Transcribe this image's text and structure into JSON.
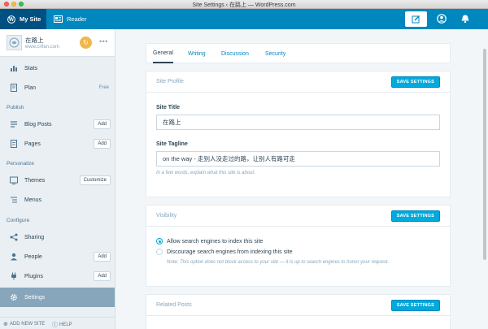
{
  "window": {
    "title": "Site Settings ‹ 在路上 — WordPress.com"
  },
  "masterbar": {
    "my_site_label": "My Site",
    "reader_label": "Reader",
    "write_icon": "pencil-square-icon",
    "me_icon": "user-circle-icon",
    "notifications_icon": "bell-icon"
  },
  "site": {
    "name": "在路上",
    "url": "www.crifan.com"
  },
  "sidebar": {
    "items": [
      {
        "label": "Stats",
        "icon": "stats-icon"
      },
      {
        "label": "Plan",
        "icon": "plan-icon",
        "badge": "Free"
      }
    ],
    "publish_heading": "Publish",
    "publish_items": [
      {
        "label": "Blog Posts",
        "icon": "posts-icon",
        "button": "Add"
      },
      {
        "label": "Pages",
        "icon": "pages-icon",
        "button": "Add"
      }
    ],
    "personalize_heading": "Personalize",
    "personalize_items": [
      {
        "label": "Themes",
        "icon": "themes-icon",
        "button": "Customize"
      },
      {
        "label": "Menus",
        "icon": "menus-icon"
      }
    ],
    "configure_heading": "Configure",
    "configure_items": [
      {
        "label": "Sharing",
        "icon": "share-icon"
      },
      {
        "label": "People",
        "icon": "people-icon",
        "button": "Add"
      },
      {
        "label": "Plugins",
        "icon": "plugins-icon",
        "button": "Add"
      },
      {
        "label": "Settings",
        "icon": "cog-icon",
        "selected": true
      }
    ],
    "footer": {
      "add_site": "ADD NEW SITE",
      "help": "HELP"
    }
  },
  "tabs": [
    {
      "label": "General",
      "active": true
    },
    {
      "label": "Writing"
    },
    {
      "label": "Discussion"
    },
    {
      "label": "Security"
    }
  ],
  "site_profile": {
    "title": "Site Profile",
    "save_label": "SAVE SETTINGS",
    "site_title_label": "Site Title",
    "site_title_value": "在路上",
    "tagline_label": "Site Tagline",
    "tagline_value": "on the way - 走别人没走过的路，让别人有路可走",
    "tagline_help": "In a few words, explain what this site is about."
  },
  "visibility": {
    "title": "Visibility",
    "save_label": "SAVE SETTINGS",
    "option_allow": "Allow search engines to index this site",
    "option_discourage": "Discourage search engines from indexing this site",
    "selected": "allow",
    "note": "Note: This option does not block access to your site — it is up to search engines to honor your request."
  },
  "related_posts": {
    "title": "Related Posts",
    "save_label": "SAVE SETTINGS"
  },
  "colors": {
    "masterbar": "#0087be",
    "masterbar_active": "#005082",
    "sidebar_bg": "#e9eff3",
    "sidebar_selected": "#87a6bc",
    "primary_button": "#00aadc",
    "badge": "#f0b849"
  }
}
